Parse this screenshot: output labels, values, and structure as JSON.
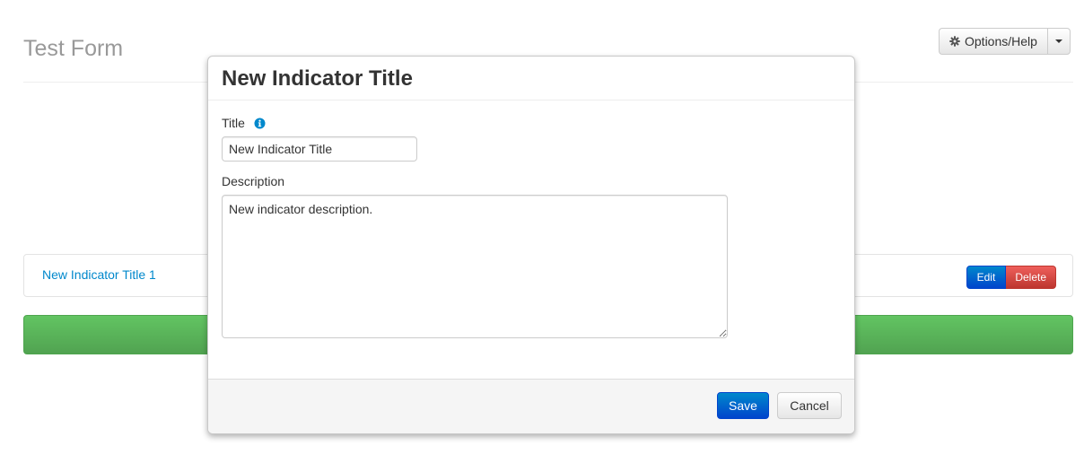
{
  "page": {
    "title": "Test Form",
    "options_label": "Options/Help"
  },
  "indicators": [
    {
      "title": "New Indicator Title 1",
      "edit_label": "Edit",
      "delete_label": "Delete"
    }
  ],
  "modal": {
    "title": "New Indicator Title",
    "title_label": "Title",
    "title_value": "New Indicator Title",
    "description_label": "Description",
    "description_value": "New indicator description.",
    "save_label": "Save",
    "cancel_label": "Cancel"
  },
  "colors": {
    "primary": "#0044cc",
    "danger": "#bd362f",
    "success": "#51a351",
    "link": "#0088cc"
  },
  "icons": {
    "options": "gear-icon",
    "options_dropdown": "caret-down-icon",
    "title_help": "info-icon"
  }
}
